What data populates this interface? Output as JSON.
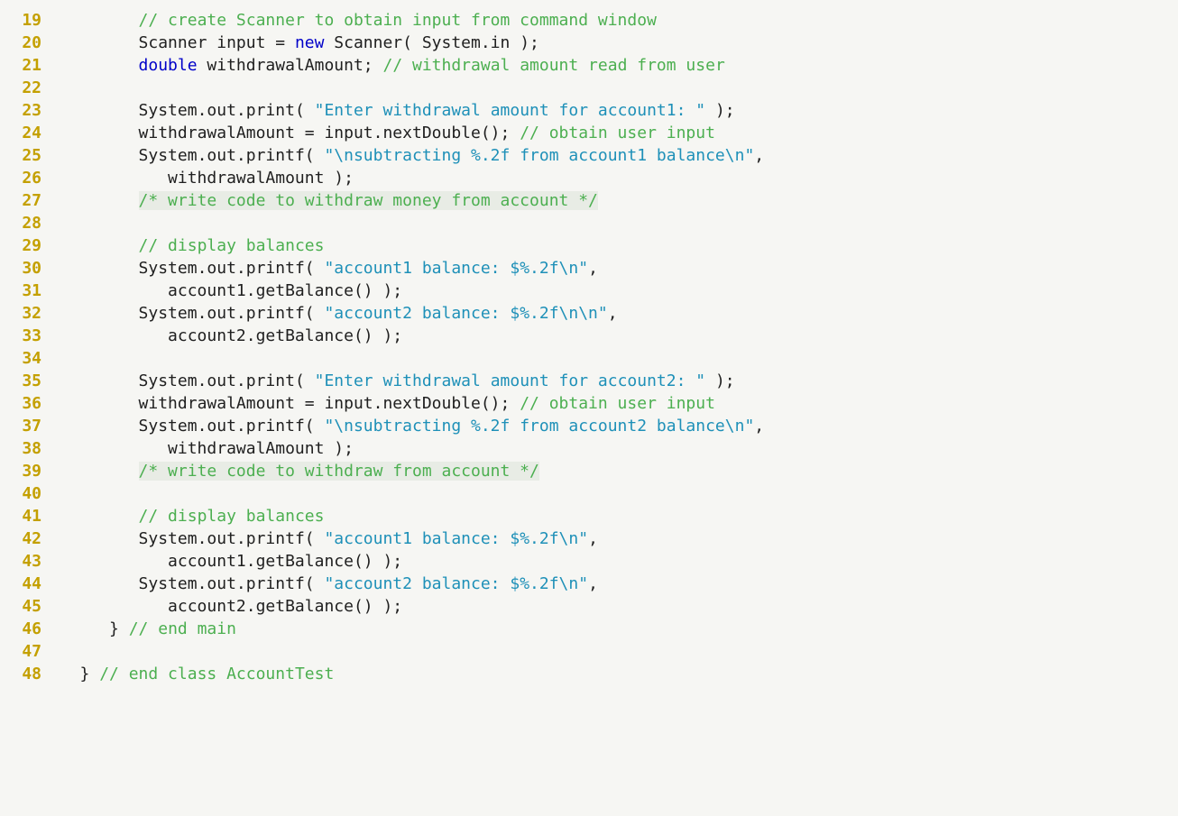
{
  "startLine": 19,
  "lines": [
    {
      "indent": "         ",
      "tokens": [
        {
          "class": "cm",
          "text": "// create Scanner to obtain input from command window"
        }
      ]
    },
    {
      "indent": "         ",
      "tokens": [
        {
          "class": "plain",
          "text": "Scanner input = "
        },
        {
          "class": "kw",
          "text": "new"
        },
        {
          "class": "plain",
          "text": " Scanner( System.in );"
        }
      ]
    },
    {
      "indent": "         ",
      "tokens": [
        {
          "class": "kw",
          "text": "double"
        },
        {
          "class": "plain",
          "text": " withdrawalAmount; "
        },
        {
          "class": "cm",
          "text": "// withdrawal amount read from user"
        }
      ]
    },
    {
      "indent": "",
      "tokens": []
    },
    {
      "indent": "         ",
      "tokens": [
        {
          "class": "plain",
          "text": "System.out.print( "
        },
        {
          "class": "str",
          "text": "\"Enter withdrawal amount for account1: \""
        },
        {
          "class": "plain",
          "text": " );"
        }
      ]
    },
    {
      "indent": "         ",
      "tokens": [
        {
          "class": "plain",
          "text": "withdrawalAmount = input.nextDouble(); "
        },
        {
          "class": "cm",
          "text": "// obtain user input"
        }
      ]
    },
    {
      "indent": "         ",
      "tokens": [
        {
          "class": "plain",
          "text": "System.out.printf( "
        },
        {
          "class": "str",
          "text": "\"\\nsubtracting %.2f from account1 balance\\n\""
        },
        {
          "class": "plain",
          "text": ","
        }
      ]
    },
    {
      "indent": "            ",
      "tokens": [
        {
          "class": "plain",
          "text": "withdrawalAmount );"
        }
      ]
    },
    {
      "indent": "         ",
      "tokens": [
        {
          "class": "cm hl",
          "text": "/* write code to withdraw money from account */"
        }
      ]
    },
    {
      "indent": "",
      "tokens": []
    },
    {
      "indent": "         ",
      "tokens": [
        {
          "class": "cm",
          "text": "// display balances"
        }
      ]
    },
    {
      "indent": "         ",
      "tokens": [
        {
          "class": "plain",
          "text": "System.out.printf( "
        },
        {
          "class": "str",
          "text": "\"account1 balance: $%.2f\\n\""
        },
        {
          "class": "plain",
          "text": ","
        }
      ]
    },
    {
      "indent": "            ",
      "tokens": [
        {
          "class": "plain",
          "text": "account1.getBalance() );"
        }
      ]
    },
    {
      "indent": "         ",
      "tokens": [
        {
          "class": "plain",
          "text": "System.out.printf( "
        },
        {
          "class": "str",
          "text": "\"account2 balance: $%.2f\\n\\n\""
        },
        {
          "class": "plain",
          "text": ","
        }
      ]
    },
    {
      "indent": "            ",
      "tokens": [
        {
          "class": "plain",
          "text": "account2.getBalance() );"
        }
      ]
    },
    {
      "indent": "",
      "tokens": []
    },
    {
      "indent": "         ",
      "tokens": [
        {
          "class": "plain",
          "text": "System.out.print( "
        },
        {
          "class": "str",
          "text": "\"Enter withdrawal amount for account2: \""
        },
        {
          "class": "plain",
          "text": " );"
        }
      ]
    },
    {
      "indent": "         ",
      "tokens": [
        {
          "class": "plain",
          "text": "withdrawalAmount = input.nextDouble(); "
        },
        {
          "class": "cm",
          "text": "// obtain user input"
        }
      ]
    },
    {
      "indent": "         ",
      "tokens": [
        {
          "class": "plain",
          "text": "System.out.printf( "
        },
        {
          "class": "str",
          "text": "\"\\nsubtracting %.2f from account2 balance\\n\""
        },
        {
          "class": "plain",
          "text": ","
        }
      ]
    },
    {
      "indent": "            ",
      "tokens": [
        {
          "class": "plain",
          "text": "withdrawalAmount );"
        }
      ]
    },
    {
      "indent": "         ",
      "tokens": [
        {
          "class": "cm hl",
          "text": "/* write code to withdraw from account */"
        }
      ]
    },
    {
      "indent": "",
      "tokens": []
    },
    {
      "indent": "         ",
      "tokens": [
        {
          "class": "cm",
          "text": "// display balances"
        }
      ]
    },
    {
      "indent": "         ",
      "tokens": [
        {
          "class": "plain",
          "text": "System.out.printf( "
        },
        {
          "class": "str",
          "text": "\"account1 balance: $%.2f\\n\""
        },
        {
          "class": "plain",
          "text": ","
        }
      ]
    },
    {
      "indent": "            ",
      "tokens": [
        {
          "class": "plain",
          "text": "account1.getBalance() );"
        }
      ]
    },
    {
      "indent": "         ",
      "tokens": [
        {
          "class": "plain",
          "text": "System.out.printf( "
        },
        {
          "class": "str",
          "text": "\"account2 balance: $%.2f\\n\""
        },
        {
          "class": "plain",
          "text": ","
        }
      ]
    },
    {
      "indent": "            ",
      "tokens": [
        {
          "class": "plain",
          "text": "account2.getBalance() );"
        }
      ]
    },
    {
      "indent": "      ",
      "tokens": [
        {
          "class": "plain",
          "text": "} "
        },
        {
          "class": "cm",
          "text": "// end main"
        }
      ]
    },
    {
      "indent": "",
      "tokens": []
    },
    {
      "indent": "   ",
      "tokens": [
        {
          "class": "plain",
          "text": "} "
        },
        {
          "class": "cm",
          "text": "// end class AccountTest"
        }
      ]
    }
  ]
}
